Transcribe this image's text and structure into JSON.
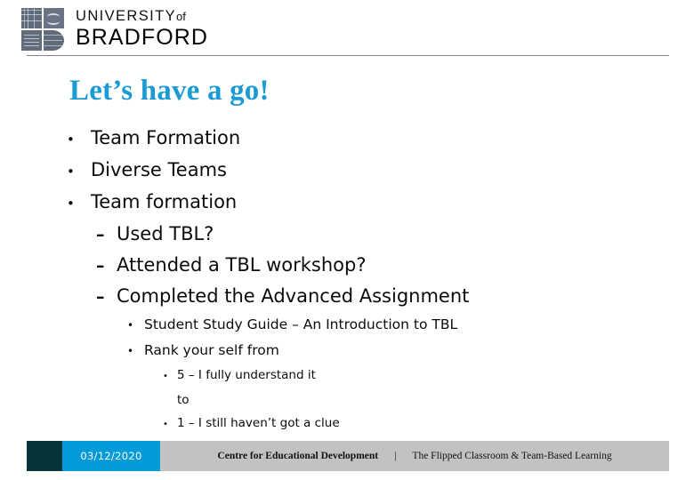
{
  "header": {
    "logo_icon": "university-crest-icon",
    "wordmark_line1_main": "UNIVERSITY",
    "wordmark_line1_of": "of",
    "wordmark_line2": "BRADFORD"
  },
  "slide": {
    "title": "Let’s have a go!",
    "title_color": "#1b9bd4",
    "bullets": [
      {
        "level": 1,
        "marker": "•",
        "text": "Team Formation"
      },
      {
        "level": 1,
        "marker": "•",
        "text": "Diverse Teams"
      },
      {
        "level": 1,
        "marker": "•",
        "text": "Team formation"
      },
      {
        "level": 2,
        "marker": "–",
        "text": "Used TBL?"
      },
      {
        "level": 2,
        "marker": "–",
        "text": "Attended a TBL workshop?"
      },
      {
        "level": 2,
        "marker": "–",
        "text": "Completed the Advanced Assignment"
      },
      {
        "level": 3,
        "marker": "•",
        "text": "Student Study Guide – An Introduction to TBL"
      },
      {
        "level": 3,
        "marker": "•",
        "text": "Rank your self from"
      },
      {
        "level": 4,
        "marker": "•",
        "text": "5 – I fully understand it"
      },
      {
        "level": 4,
        "marker": "",
        "text": "to"
      },
      {
        "level": 4,
        "marker": "•",
        "text": "1 – I still haven’t got a clue"
      }
    ]
  },
  "footer": {
    "accent_dark_color": "#05343b",
    "accent_date_color": "#039ad9",
    "bar_color": "#c2c2c2",
    "date": "03/12/2020",
    "department": "Centre for Educational Development",
    "separator": "|",
    "course": "The Flipped Classroom & Team-Based Learning"
  }
}
